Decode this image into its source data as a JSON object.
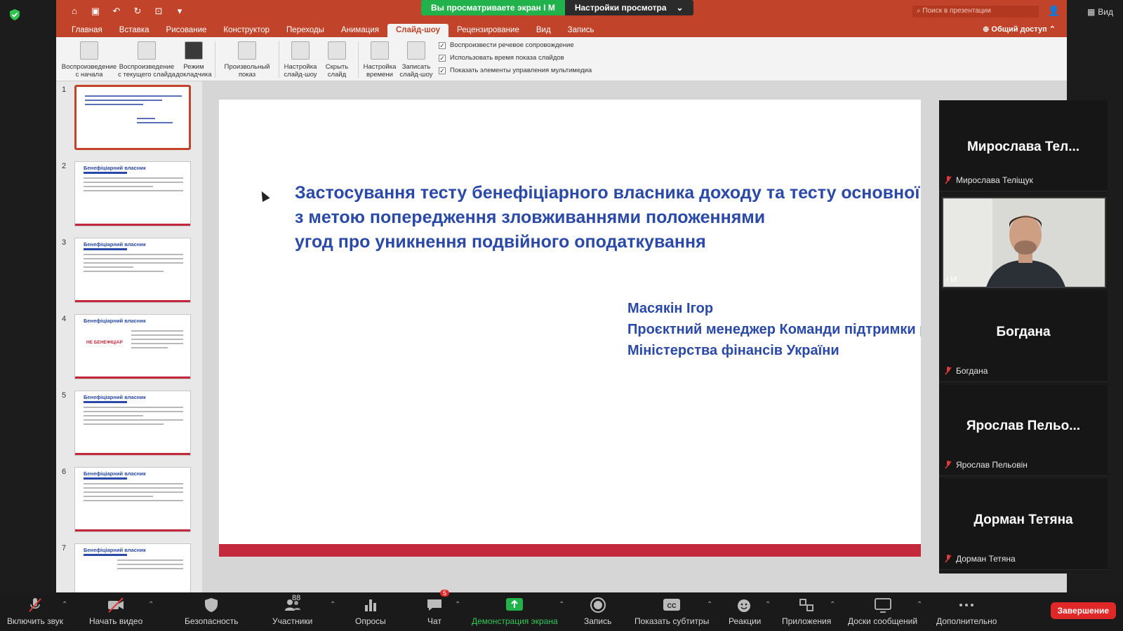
{
  "zoom": {
    "share_banner": "Вы просматриваете экран I M",
    "view_options": "Настройки просмотра",
    "view_button": "Вид"
  },
  "ppt": {
    "search_placeholder": "Поиск в презентации",
    "tabs": [
      "Главная",
      "Вставка",
      "Рисование",
      "Конструктор",
      "Переходы",
      "Анимация",
      "Слайд-шоу",
      "Рецензирование",
      "Вид",
      "Запись"
    ],
    "active_tab": "Слайд-шоу",
    "share_access": "Общий доступ",
    "ribbon": {
      "from_start_1": "Воспроизведение",
      "from_start_2": "с начала",
      "from_current_1": "Воспроизведение",
      "from_current_2": "с текущего слайда",
      "presenter_1": "Режим",
      "presenter_2": "докладчика",
      "custom_1": "Произвольный",
      "custom_2": "показ",
      "setup_1": "Настройка",
      "setup_2": "слайд-шоу",
      "hide_1": "Скрыть",
      "hide_2": "слайд",
      "timing_1": "Настройка",
      "timing_2": "времени",
      "record_1": "Записать",
      "record_2": "слайд-шоу",
      "checks": [
        "Воспроизвести речевое сопровождение",
        "Использовать время показа слайдов",
        "Показать элементы управления мультимедиа"
      ]
    },
    "thumbnails": [
      {
        "num": "1",
        "title": ""
      },
      {
        "num": "2",
        "title": "Бенефіціарний власник"
      },
      {
        "num": "3",
        "title": "Бенефіціарний власник"
      },
      {
        "num": "4",
        "title": "Бенефіціарний власник",
        "red": "НЕ БЕНЕФІЦІАР"
      },
      {
        "num": "5",
        "title": "Бенефіціарний власник"
      },
      {
        "num": "6",
        "title": "Бенефіціарний власник"
      },
      {
        "num": "7",
        "title": "Бенефіціарний власник"
      }
    ],
    "slide": {
      "title_lines": [
        "Застосування тесту бенефіціарного власника доходу та тесту основної мети",
        "з метою попередження зловживаннями положеннями",
        "угод про уникнення подвійного оподаткування"
      ],
      "author_lines": [
        "Масякін Ігор",
        "Проєктний менеджер Команди підтримки реформ",
        "Міністерства фінансів України"
      ]
    }
  },
  "participants": [
    {
      "display": "Мирослава  Тел...",
      "name": "Мирослава Теліщук"
    },
    {
      "video_label": "I M"
    },
    {
      "display": "Богдана",
      "name": "Богдана"
    },
    {
      "display": "Ярослав  Пельо...",
      "name": "Ярослав Пельовін"
    },
    {
      "display": "Дорман Тетяна",
      "name": "Дорман Тетяна"
    }
  ],
  "toolbar": {
    "unmute": "Включить звук",
    "start_video": "Начать видео",
    "security": "Безопасность",
    "participants": "Участники",
    "participants_count": "88",
    "polls": "Опросы",
    "chat": "Чат",
    "chat_badge": "5",
    "share_screen": "Демонстрация экрана",
    "record": "Запись",
    "captions": "Показать субтитры",
    "reactions": "Реакции",
    "apps": "Приложения",
    "whiteboards": "Доски сообщений",
    "more": "Дополнительно",
    "end": "Завершение"
  },
  "colors": {
    "ppt_accent": "#c1432a",
    "slide_text": "#2a49a8",
    "slide_bar": "#c4283c",
    "zoom_green": "#22b24c",
    "end_red": "#e02828"
  }
}
